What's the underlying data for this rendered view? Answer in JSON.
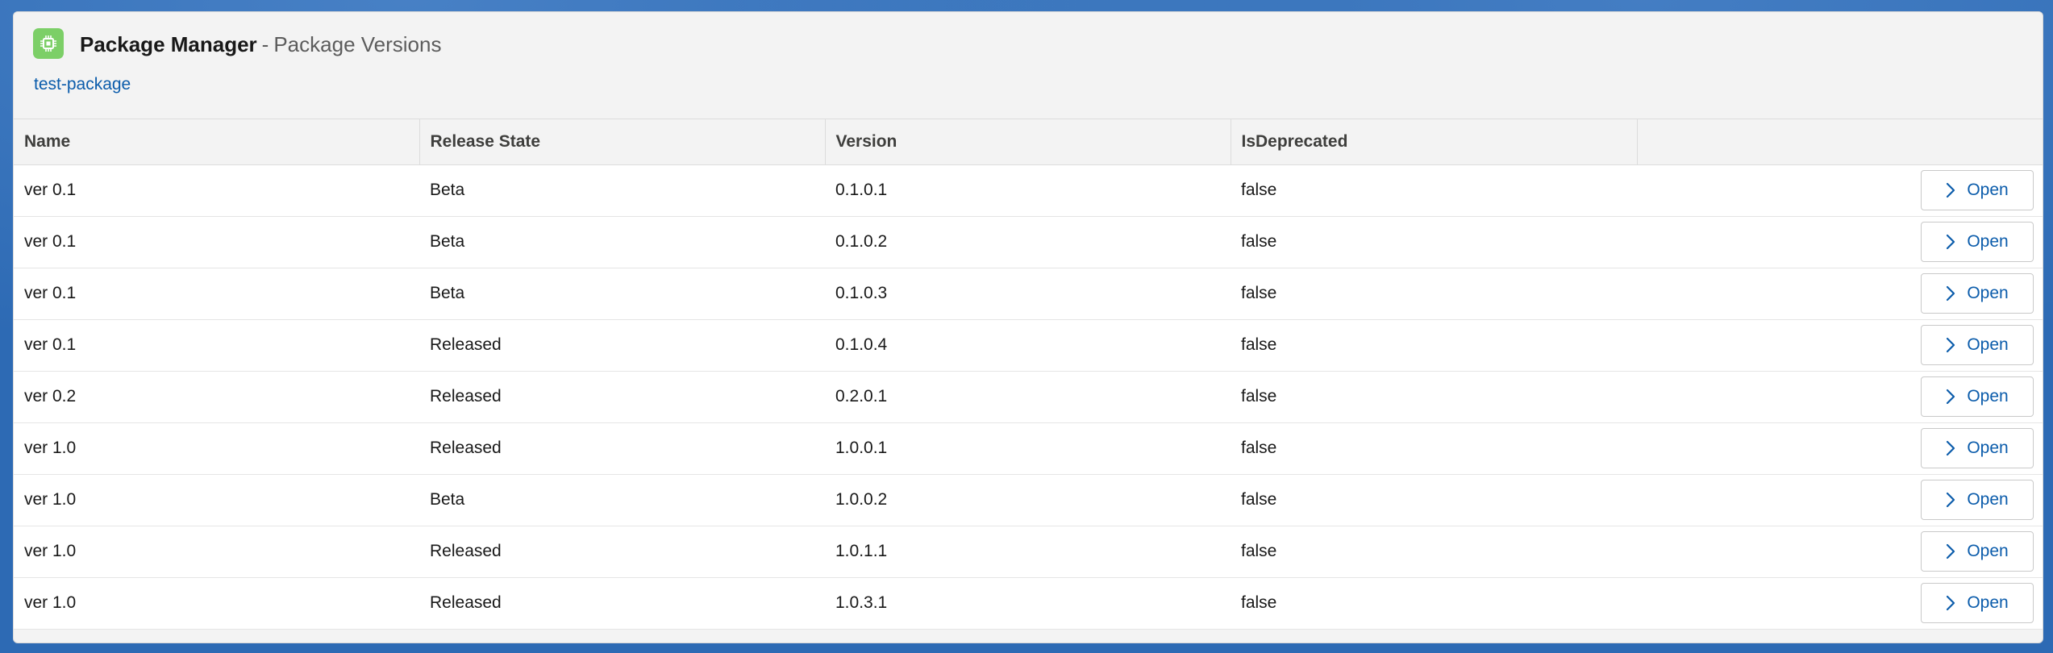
{
  "header": {
    "app_icon": "package-chip-icon",
    "app_name": "Package Manager",
    "separator": "-",
    "page_name": "Package Versions",
    "breadcrumb": "test-package"
  },
  "table": {
    "columns": [
      "Name",
      "Release State",
      "Version",
      "IsDeprecated",
      ""
    ],
    "rows": [
      {
        "name": "ver 0.1",
        "release_state": "Beta",
        "version": "0.1.0.1",
        "is_deprecated": "false",
        "action": "Open"
      },
      {
        "name": "ver 0.1",
        "release_state": "Beta",
        "version": "0.1.0.2",
        "is_deprecated": "false",
        "action": "Open"
      },
      {
        "name": "ver 0.1",
        "release_state": "Beta",
        "version": "0.1.0.3",
        "is_deprecated": "false",
        "action": "Open"
      },
      {
        "name": "ver 0.1",
        "release_state": "Released",
        "version": "0.1.0.4",
        "is_deprecated": "false",
        "action": "Open"
      },
      {
        "name": "ver 0.2",
        "release_state": "Released",
        "version": "0.2.0.1",
        "is_deprecated": "false",
        "action": "Open"
      },
      {
        "name": "ver 1.0",
        "release_state": "Released",
        "version": "1.0.0.1",
        "is_deprecated": "false",
        "action": "Open"
      },
      {
        "name": "ver 1.0",
        "release_state": "Beta",
        "version": "1.0.0.2",
        "is_deprecated": "false",
        "action": "Open"
      },
      {
        "name": "ver 1.0",
        "release_state": "Released",
        "version": "1.0.1.1",
        "is_deprecated": "false",
        "action": "Open"
      },
      {
        "name": "ver 1.0",
        "release_state": "Released",
        "version": "1.0.3.1",
        "is_deprecated": "false",
        "action": "Open"
      }
    ]
  },
  "colors": {
    "accent": "#0b5cab",
    "app_icon_bg": "#7ccf67",
    "background": "#2d6ab4"
  }
}
